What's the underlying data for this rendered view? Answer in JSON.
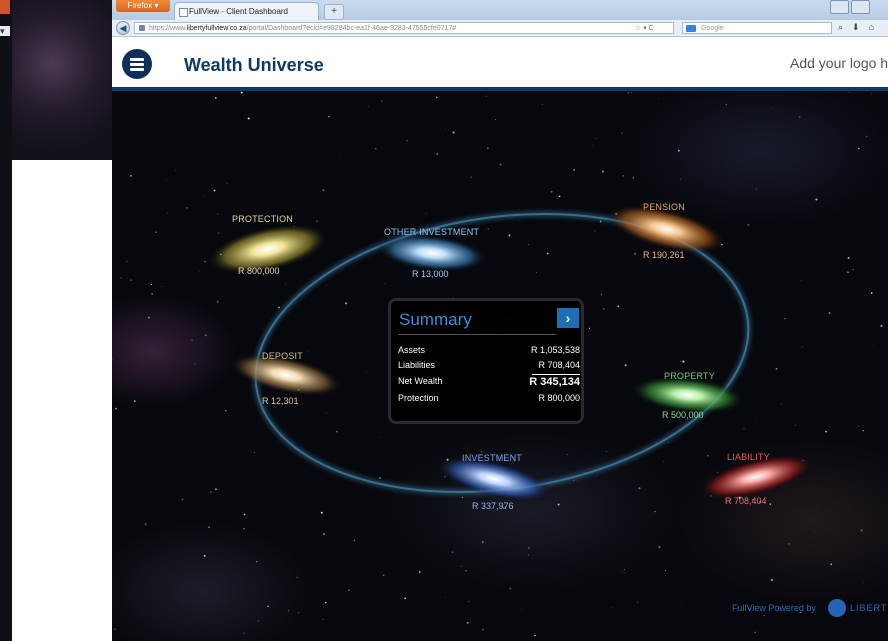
{
  "browser": {
    "firefox_button": "Firefox",
    "tab_title": "FullView - Client Dashboard",
    "newtab_label": "+",
    "url_prefix": "https://www.",
    "url_domain": "libertyfullview.co.za",
    "url_rest": "/portal/Dashboard?ecid=e98284bc-ea1f-46ae-9283-47555cfe0717#",
    "search_placeholder": "Google"
  },
  "header": {
    "app_title": "Wealth Universe",
    "logo_text": "Add your logo here"
  },
  "galaxies": [
    {
      "key": "protection",
      "label": "PROTECTION",
      "value": "R 800,000",
      "color": "#d8c66a"
    },
    {
      "key": "other_investment",
      "label": "OTHER INVESTMENT",
      "value": "R 13,000",
      "color": "#78b9ea"
    },
    {
      "key": "pension",
      "label": "PENSION",
      "value": "R 190,261",
      "color": "#d99346"
    },
    {
      "key": "deposit",
      "label": "DEPOSIT",
      "value": "R 12,301",
      "color": "#d1b27a"
    },
    {
      "key": "property",
      "label": "PROPERTY",
      "value": "R 500,000",
      "color": "#5fc160"
    },
    {
      "key": "investment",
      "label": "INVESTMENT",
      "value": "R 337,976",
      "color": "#5b8fde"
    },
    {
      "key": "liability",
      "label": "LIABILITY",
      "value": "R 708,404",
      "color": "#e04848"
    }
  ],
  "summary": {
    "title": "Summary",
    "arrow": "›",
    "rows": [
      {
        "label": "Assets",
        "value": "R 1,053,538"
      },
      {
        "label": "Liabilities",
        "value": "R 708,404"
      },
      {
        "label": "Net Wealth",
        "value": "R 345,134"
      },
      {
        "label": "Protection",
        "value": "R 800,000"
      }
    ]
  },
  "footer": {
    "powered_by": "FullView Powered by",
    "brand": "LIBERTY"
  }
}
